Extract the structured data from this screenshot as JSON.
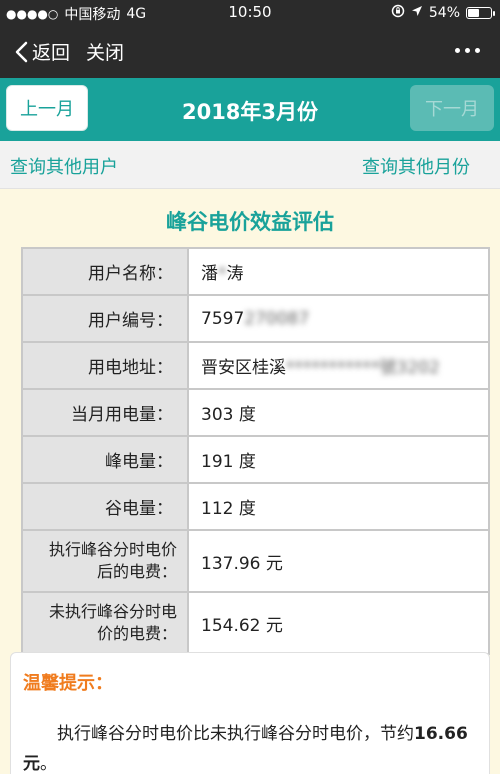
{
  "status_bar": {
    "signal": "●●●●○",
    "carrier": "中国移动",
    "network": "4G",
    "time": "10:50",
    "battery_text": "54%",
    "battery_level": 0.54
  },
  "nav": {
    "back_label": "返回",
    "close_label": "关闭"
  },
  "month_header": {
    "prev_label": "上一月",
    "title": "2018年3月份",
    "next_label": "下一月"
  },
  "links": {
    "other_user": "查询其他用户",
    "other_month": "查询其他月份"
  },
  "section_title": "峰谷电价效益评估",
  "table": {
    "rows": [
      {
        "label": "用户名称：",
        "value": "潘",
        "value_blur": "*",
        "value_tail": "涛"
      },
      {
        "label": "用户编号：",
        "value": "7597",
        "value_blur": "270087",
        "value_tail": ""
      },
      {
        "label": "用电地址：",
        "value": "晋安区桂溪",
        "value_blur": "***********號3202",
        "value_tail": ""
      },
      {
        "label": "当月用电量：",
        "value": "303 度"
      },
      {
        "label": "峰电量：",
        "value": "191 度"
      },
      {
        "label": "谷电量：",
        "value": "112 度"
      },
      {
        "label_line1": "执行峰谷分时电价",
        "label_line2": "后的电费：",
        "value": "137.96 元"
      },
      {
        "label_line1": "未执行峰谷分时电",
        "label_line2": "价的电费：",
        "value": "154.62 元"
      }
    ]
  },
  "tips": {
    "title": "温馨提示：",
    "text": "执行峰谷分时电价比未执行峰谷分时电价，节约",
    "amount": "16.66元",
    "end": "。"
  },
  "colors": {
    "accent": "#19a29a",
    "header_bg": "#2b2b2b",
    "tips_title": "#f07c1e",
    "page_bg": "#fdf8e1"
  }
}
